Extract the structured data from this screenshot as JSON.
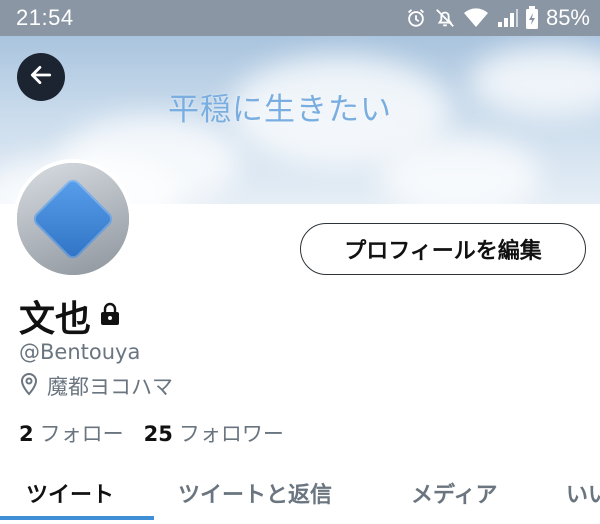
{
  "status_bar": {
    "time": "21:54",
    "icons": [
      "alarm-icon",
      "mute-icon",
      "wifi-icon",
      "signal-icon",
      "battery-icon"
    ],
    "battery": "85%"
  },
  "banner": {
    "text": "平穏に生きたい"
  },
  "profile": {
    "display_name": "文也",
    "handle": "@Bentouya",
    "location": "魔都ヨコハマ",
    "protected_icon": "lock-icon",
    "edit_button": "プロフィールを編集"
  },
  "stats": {
    "following_count": "2",
    "following_label": "フォロー",
    "followers_count": "25",
    "followers_label": "フォロワー"
  },
  "tabs": [
    {
      "label": "ツイート",
      "active": true
    },
    {
      "label": "ツイートと返信",
      "active": false
    },
    {
      "label": "メディア",
      "active": false
    },
    {
      "label": "いい",
      "active": false
    }
  ],
  "colors": {
    "accent": "#3f8fd6",
    "text_primary": "#111111",
    "text_secondary": "#6a7580",
    "status_bar_bg": "#8a96a4"
  }
}
